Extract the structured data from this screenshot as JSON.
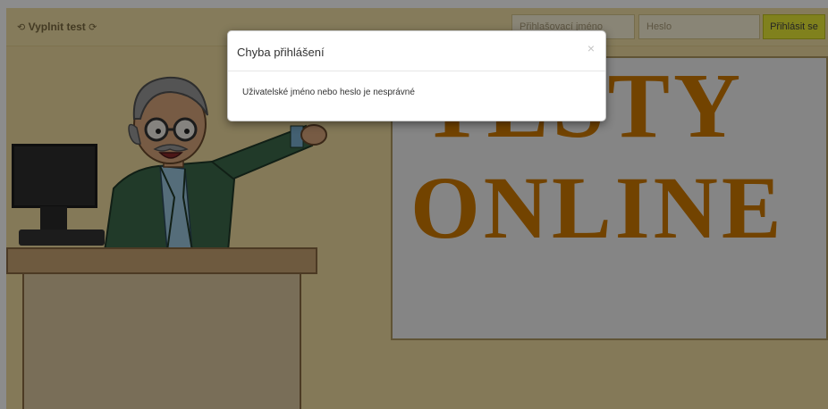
{
  "navbar": {
    "brand": {
      "icon_left": "⟲",
      "label": "Vyplnit test",
      "icon_right": "⟳",
      "icon_name": "refresh-icon"
    },
    "username": {
      "placeholder": "Přihlašovací jméno",
      "value": ""
    },
    "password": {
      "placeholder": "Heslo",
      "value": ""
    },
    "login_button": "Přihlásit se"
  },
  "hero": {
    "line1": "TESTY",
    "line2": "ONLINE",
    "text_color": "#d07a00"
  },
  "modal": {
    "title": "Chyba přihlášení",
    "close_label": "×",
    "message": "Uživatelské jméno nebo heslo je nesprávné"
  },
  "colors": {
    "page_bg": "#f0dca0",
    "accent_button": "#e9ec35",
    "overlay": "rgba(0,0,0,0.45)"
  }
}
